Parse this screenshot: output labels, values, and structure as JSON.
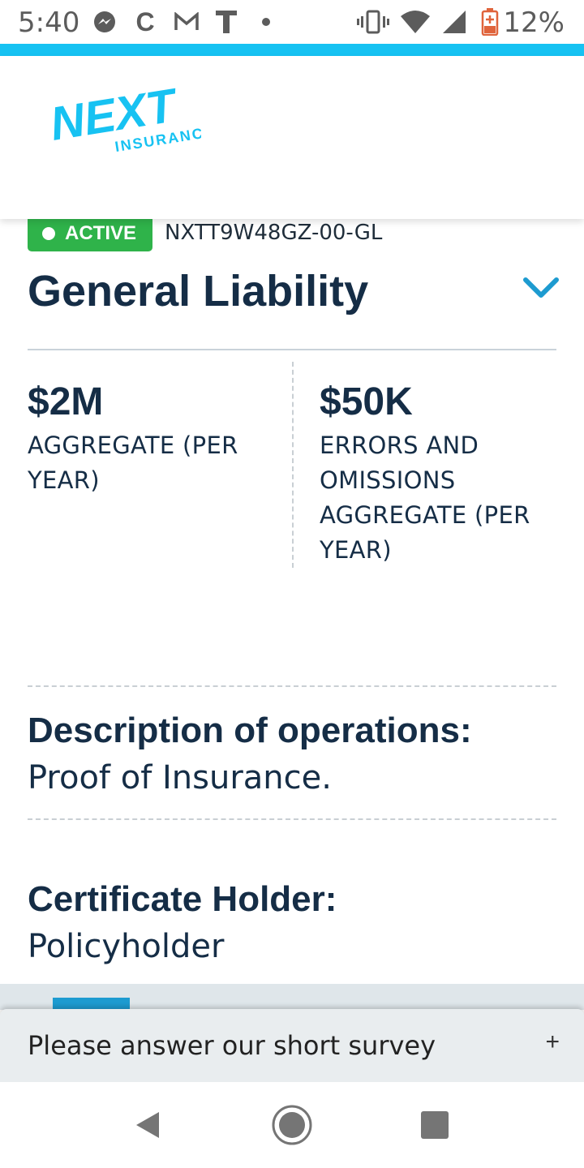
{
  "status_bar": {
    "time": "5:40",
    "battery_percent": "12%",
    "icons": [
      "messenger-icon",
      "c-app-icon",
      "gmail-icon",
      "t-app-icon",
      "dot-icon",
      "vibrate-icon",
      "wifi-icon",
      "signal-icon",
      "battery-low-icon"
    ]
  },
  "colors": {
    "accent": "#17c2f2",
    "active_green": "#2fb34a",
    "title_navy": "#152d46",
    "chevron_blue": "#1d9bd0"
  },
  "brand": {
    "logo_main": "NEXT",
    "logo_sub": "INSURANCE"
  },
  "policy": {
    "status": "ACTIVE",
    "number": "NXTT9W48GZ-00-GL",
    "title": "General Liability",
    "metrics": [
      {
        "value": "$2M",
        "label": "AGGREGATE (PER YEAR)"
      },
      {
        "value": "$50K",
        "label": "ERRORS AND OMISSIONS AGGREGATE (PER YEAR)"
      }
    ],
    "description_heading": "Description of operations:",
    "description_value": "Proof of Insurance.",
    "holder_heading": "Certificate Holder:",
    "holder_value": "Policyholder"
  },
  "survey": {
    "text": "Please answer our short survey",
    "toggle": "+"
  },
  "nav": {
    "icons": [
      "back-icon",
      "home-icon",
      "recents-icon"
    ]
  }
}
